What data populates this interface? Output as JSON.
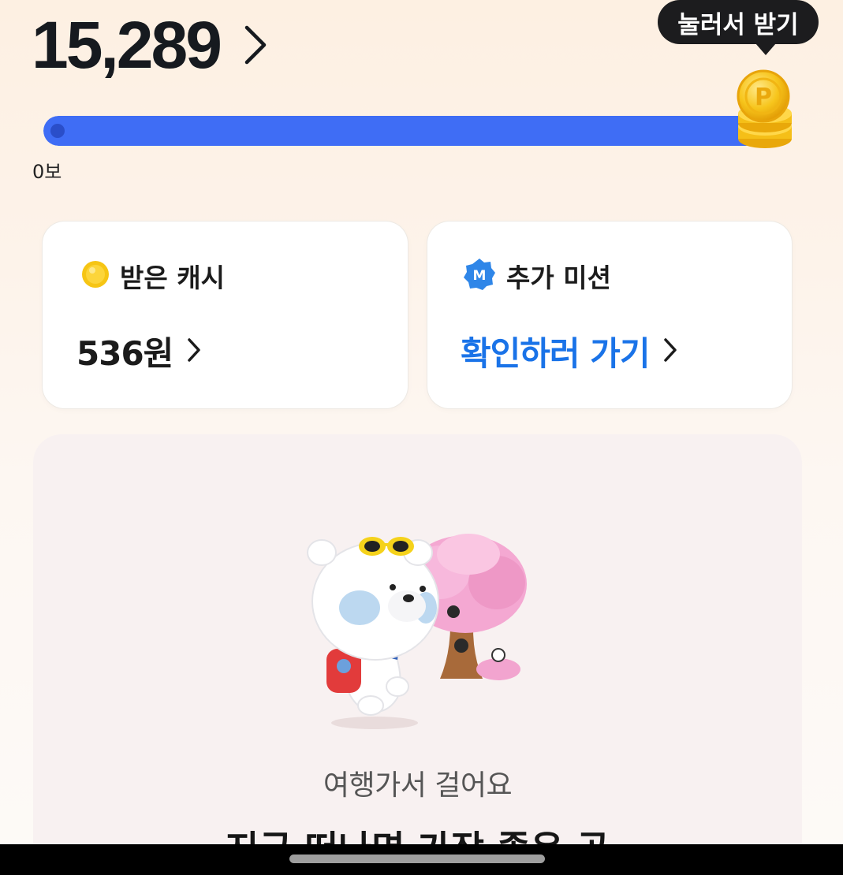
{
  "steps": {
    "count": "15,289",
    "start_label": "0보",
    "progress": 1.0
  },
  "reward_tooltip": {
    "label": "눌러서 받기",
    "coin_letter": "P"
  },
  "cards": {
    "cash": {
      "title": "받은 캐시",
      "value": "536원",
      "icon": "gold-coin-icon"
    },
    "mission": {
      "title": "추가 미션",
      "badge_letter": "M",
      "value": "확인하러 가기",
      "icon": "mission-badge-icon"
    }
  },
  "promo": {
    "subtitle": "여행가서 걸어요",
    "headline": "지금 떠나면 가장 좋은 곳"
  },
  "colors": {
    "progress_fill": "#3f6df5",
    "link_blue": "#1a73e8",
    "tooltip_bg": "#1c1c1e",
    "coin_gold": "#f5c01a"
  }
}
